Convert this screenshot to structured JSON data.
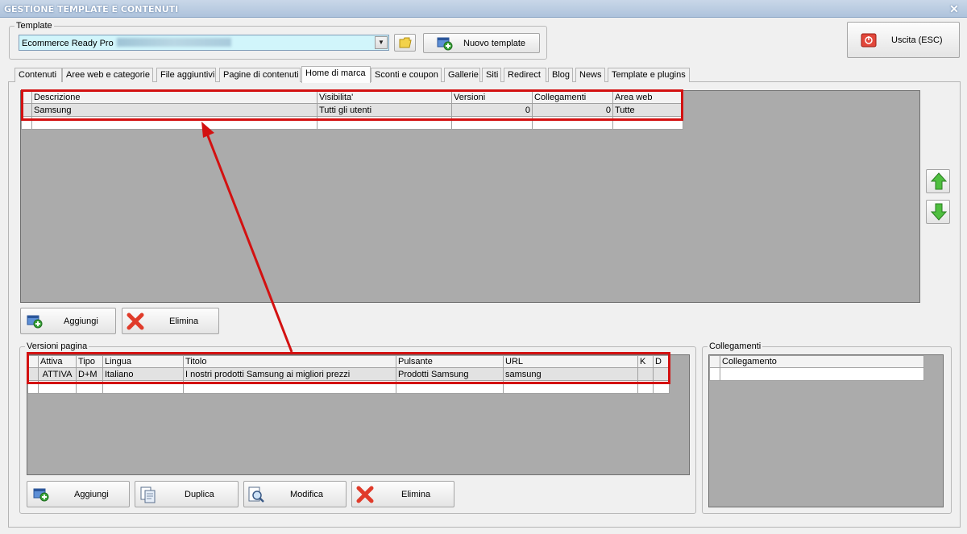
{
  "window": {
    "title": "GESTIONE TEMPLATE E CONTENUTI",
    "close_glyph": "✕"
  },
  "template_group": {
    "legend": "Template",
    "selected_value": "Ecommerce Ready Pro",
    "new_template_label": "Nuovo template"
  },
  "exit_button": {
    "label": "Uscita (ESC)"
  },
  "tabs": [
    {
      "label": "Contenuti"
    },
    {
      "label": "Aree web e categorie"
    },
    {
      "label": "File aggiuntivi"
    },
    {
      "label": "Pagine di contenuti"
    },
    {
      "label": "Home di marca"
    },
    {
      "label": "Sconti e coupon"
    },
    {
      "label": "Gallerie"
    },
    {
      "label": "Siti"
    },
    {
      "label": "Redirect"
    },
    {
      "label": "Blog"
    },
    {
      "label": "News"
    },
    {
      "label": "Template e plugins"
    }
  ],
  "active_tab": "Home di marca",
  "brands_grid": {
    "columns": [
      "Descrizione",
      "Visibilita'",
      "Versioni",
      "Collegamenti",
      "Area web"
    ],
    "rows": [
      {
        "descrizione": "Samsung",
        "visibilita": "Tutti gli utenti",
        "versioni": "0",
        "collegamenti": "0",
        "area_web": "Tutte"
      }
    ]
  },
  "brands_actions": {
    "add_label": "Aggiungi",
    "delete_label": "Elimina"
  },
  "versions_group": {
    "legend": "Versioni pagina",
    "columns": [
      "Attiva",
      "Tipo",
      "Lingua",
      "Titolo",
      "Pulsante",
      "URL",
      "K",
      "D"
    ],
    "rows": [
      {
        "attiva": "ATTIVA",
        "tipo": "D+M",
        "lingua": "Italiano",
        "titolo": "I nostri prodotti Samsung ai migliori prezzi",
        "pulsante": "Prodotti Samsung",
        "url": "samsung",
        "k": "",
        "d": ""
      }
    ],
    "add_label": "Aggiungi",
    "duplicate_label": "Duplica",
    "edit_label": "Modifica",
    "delete_label": "Elimina"
  },
  "links_group": {
    "legend": "Collegamenti",
    "columns": [
      "Collegamento"
    ]
  },
  "colors": {
    "highlight": "#d31111",
    "combo_bg": "#d1f5fb",
    "grid_bg": "#ababab"
  }
}
